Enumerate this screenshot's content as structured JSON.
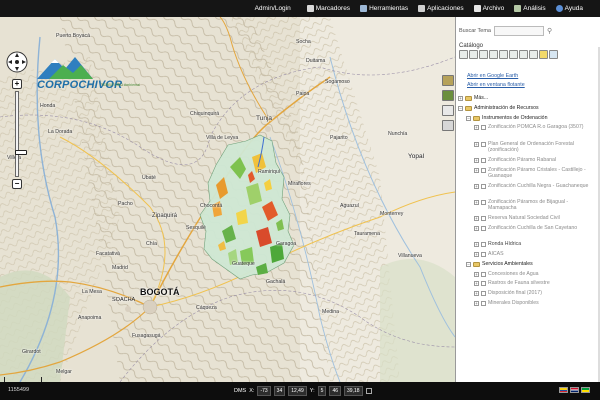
{
  "topbar": {
    "items": [
      {
        "label": "Admin/Login",
        "icon": "login"
      },
      {
        "label": "Marcadores",
        "icon": "bookmark-icon"
      },
      {
        "label": "Herramientas",
        "icon": "wrench-icon"
      },
      {
        "label": "Aplicaciones",
        "icon": "apps-icon"
      },
      {
        "label": "Archivo",
        "icon": "file-icon"
      },
      {
        "label": "Análisis",
        "icon": "analysis-icon"
      },
      {
        "label": "Ayuda",
        "icon": "help-icon"
      }
    ]
  },
  "logo": {
    "name": "CORPOCHIVOR",
    "tagline": "TERRITORIO Ambiental"
  },
  "map": {
    "places": [
      {
        "label": "Tunja",
        "cls": "med"
      },
      {
        "label": "BOGOTÁ",
        "cls": "big"
      },
      {
        "label": "SOACHA",
        "cls": "med"
      },
      {
        "label": "Yopal",
        "cls": "med"
      },
      {
        "label": "Zipaquirá",
        "cls": "med"
      },
      {
        "label": "Sogamoso",
        "cls": ""
      },
      {
        "label": "Duitama",
        "cls": ""
      },
      {
        "label": "Villeta",
        "cls": ""
      },
      {
        "label": "Chía",
        "cls": ""
      },
      {
        "label": "Madrid",
        "cls": ""
      },
      {
        "label": "Facatativá",
        "cls": ""
      },
      {
        "label": "Girardot",
        "cls": ""
      },
      {
        "label": "La Dorada",
        "cls": ""
      },
      {
        "label": "Puerto Boyacá",
        "cls": ""
      },
      {
        "label": "Guateque",
        "cls": ""
      },
      {
        "label": "Miraflores",
        "cls": ""
      },
      {
        "label": "Garagoa",
        "cls": ""
      },
      {
        "label": "Ubaté",
        "cls": ""
      },
      {
        "label": "Chiquinquirá",
        "cls": ""
      },
      {
        "label": "Paipa",
        "cls": ""
      },
      {
        "label": "Ramiriquí",
        "cls": ""
      },
      {
        "label": "Tauramena",
        "cls": ""
      },
      {
        "label": "Aguazul",
        "cls": ""
      },
      {
        "label": "Villa de Leyva",
        "cls": ""
      },
      {
        "label": "Gachalá",
        "cls": ""
      },
      {
        "label": "Medina",
        "cls": ""
      },
      {
        "label": "Cáqueza",
        "cls": ""
      },
      {
        "label": "Fusagasugá",
        "cls": ""
      },
      {
        "label": "Sesquilé",
        "cls": ""
      },
      {
        "label": "Chocontá",
        "cls": ""
      },
      {
        "label": "Pacho",
        "cls": ""
      },
      {
        "label": "La Mesa",
        "cls": ""
      },
      {
        "label": "Anapoima",
        "cls": ""
      },
      {
        "label": "Melgar",
        "cls": ""
      },
      {
        "label": "Honda",
        "cls": ""
      },
      {
        "label": "Socha",
        "cls": ""
      },
      {
        "label": "Pajarito",
        "cls": ""
      },
      {
        "label": "Monterrey",
        "cls": ""
      },
      {
        "label": "Villanueva",
        "cls": ""
      },
      {
        "label": "Nunchía",
        "cls": ""
      }
    ]
  },
  "bottom_tools": {
    "count": 18
  },
  "status": {
    "scale": "1155499",
    "dms_label": "DMS",
    "x_label": "X:",
    "x_deg": "-73",
    "x_min": "34",
    "x_sec": "12,49",
    "y_label": "Y:",
    "y_deg": "5",
    "y_min": "46",
    "y_sec": "39,18"
  },
  "panel": {
    "search_label": "Buscar Tema",
    "search_placeholder": "",
    "catalog_label": "Catálogo",
    "link_gearth": "Abrir en Google Earth",
    "link_newwin": "Abrir en ventana flotante",
    "tree": [
      {
        "label": "Más...",
        "kind": "group",
        "level": 0,
        "pm": "+",
        "dim": false
      },
      {
        "label": "Administración de Recursos",
        "kind": "group",
        "level": 0,
        "pm": "−",
        "dim": false
      },
      {
        "label": "Instrumentos de Ordenación",
        "kind": "group",
        "level": 1,
        "pm": "−",
        "dim": false
      },
      {
        "label": "Zonificación POMCA R.o Garagoa (3507)",
        "kind": "layer",
        "level": 2,
        "pm": "+",
        "dim": true
      },
      {
        "label": "Plan General de Ordenación Forestal (zonificación)",
        "kind": "layer",
        "level": 2,
        "pm": "+",
        "dim": true
      },
      {
        "label": "Zonificación Páramo Rabanal",
        "kind": "layer",
        "level": 2,
        "pm": "+",
        "dim": true
      },
      {
        "label": "Zonificación Páramo Cristales - Castillejo - Guanaque",
        "kind": "layer",
        "level": 2,
        "pm": "+",
        "dim": true
      },
      {
        "label": "Zonificación Cuchilla Negra - Guachaneque",
        "kind": "layer",
        "level": 2,
        "pm": "+",
        "dim": true
      },
      {
        "label": "Zonificación Páramos de Bijagual - Mamapacha",
        "kind": "layer",
        "level": 2,
        "pm": "+",
        "dim": true
      },
      {
        "label": "Reserva Natural Sociedad Civil",
        "kind": "layer",
        "level": 2,
        "pm": "+",
        "dim": true
      },
      {
        "label": "Zonificación Cuchilla de San Cayetano",
        "kind": "layer",
        "level": 2,
        "pm": "+",
        "dim": true
      },
      {
        "label": "Ronda Hídrica",
        "kind": "layer",
        "level": 2,
        "pm": "+",
        "dim": false
      },
      {
        "label": "AICAS",
        "kind": "layer",
        "level": 2,
        "pm": "+",
        "dim": true
      },
      {
        "label": "Servicios Ambientales",
        "kind": "group",
        "level": 1,
        "pm": "−",
        "dim": false
      },
      {
        "label": "Concesiones de Agua",
        "kind": "layer",
        "level": 2,
        "pm": "+",
        "dim": true
      },
      {
        "label": "Rastros de Fauna silvestre",
        "kind": "layer",
        "level": 2,
        "pm": "+",
        "dim": true
      },
      {
        "label": "Disposición final (2017)",
        "kind": "layer",
        "level": 2,
        "pm": "+",
        "dim": true
      },
      {
        "label": "Minerales Disponibles",
        "kind": "layer",
        "level": 2,
        "pm": "+",
        "dim": true
      }
    ]
  }
}
